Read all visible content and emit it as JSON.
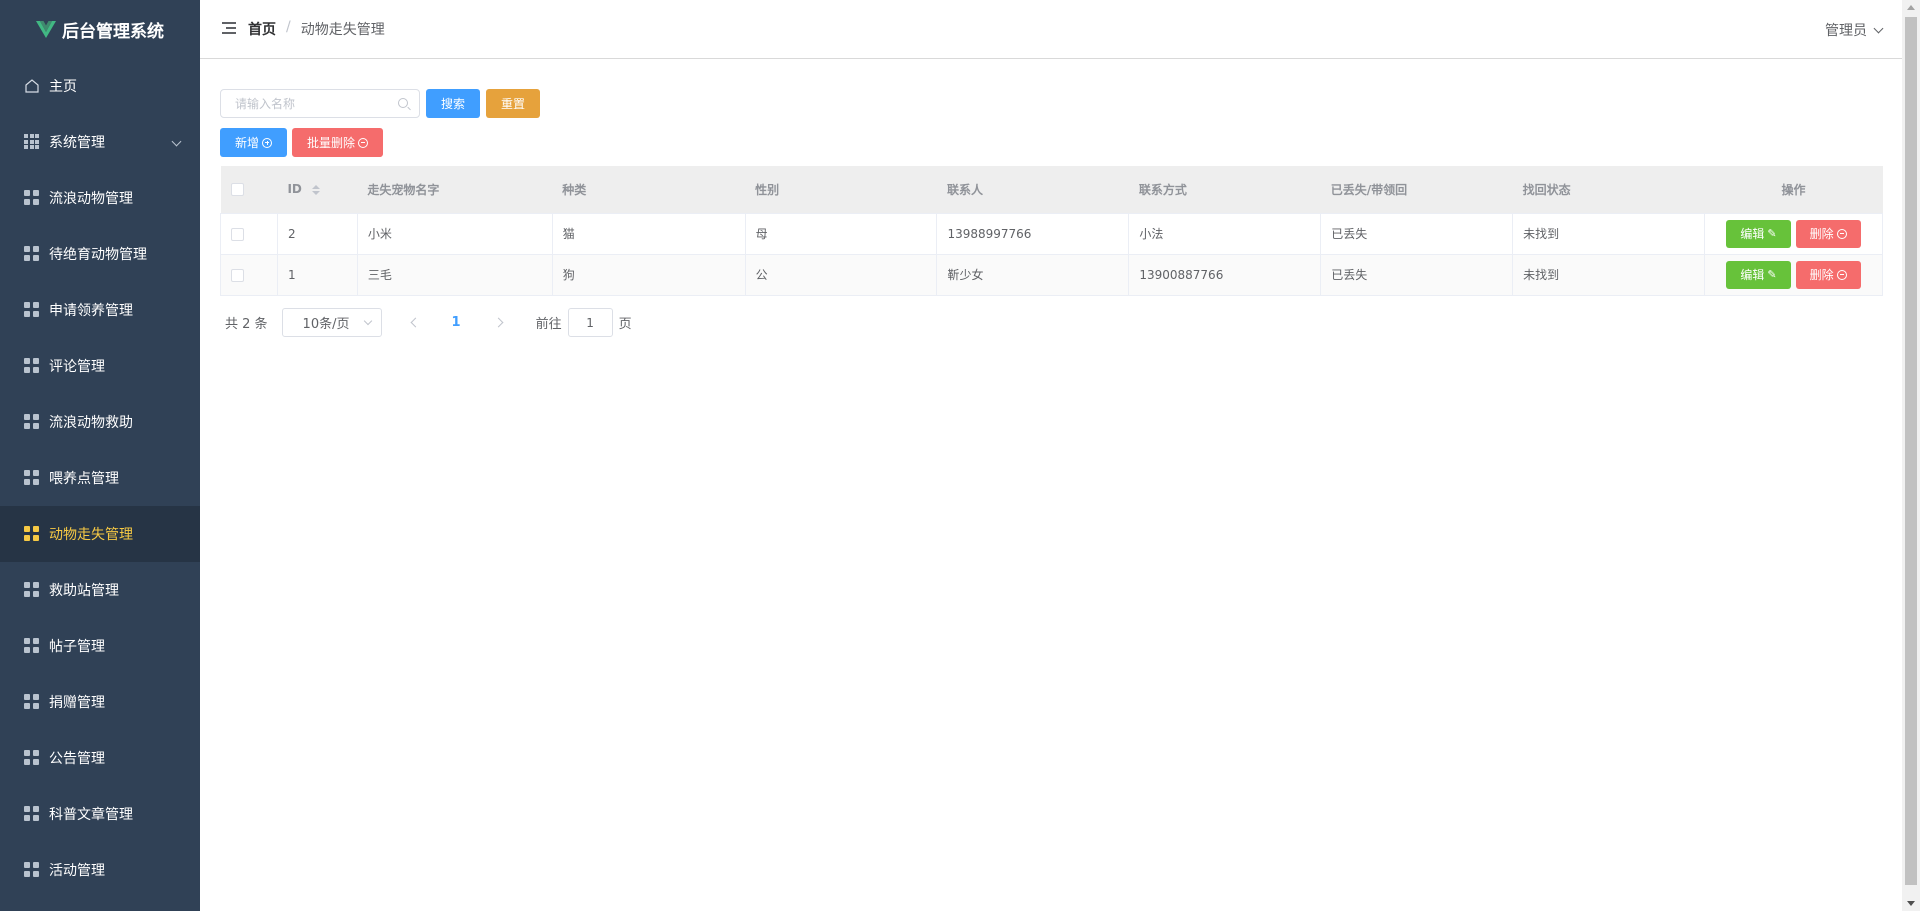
{
  "app": {
    "title": "后台管理系统",
    "brand_color": "#41b883"
  },
  "sidebar": {
    "items": [
      {
        "label": "主页",
        "icon": "home-icon"
      },
      {
        "label": "系统管理",
        "icon": "grid-icon"
      },
      {
        "label": "流浪动物管理",
        "icon": "menu-icon"
      },
      {
        "label": "待绝育动物管理",
        "icon": "menu-icon"
      },
      {
        "label": "申请领养管理",
        "icon": "menu-icon"
      },
      {
        "label": "评论管理",
        "icon": "menu-icon"
      },
      {
        "label": "流浪动物救助",
        "icon": "menu-icon"
      },
      {
        "label": "喂养点管理",
        "icon": "menu-icon"
      },
      {
        "label": "动物走失管理",
        "icon": "menu-icon"
      },
      {
        "label": "救助站管理",
        "icon": "menu-icon"
      },
      {
        "label": "帖子管理",
        "icon": "menu-icon"
      },
      {
        "label": "捐赠管理",
        "icon": "menu-icon"
      },
      {
        "label": "公告管理",
        "icon": "menu-icon"
      },
      {
        "label": "科普文章管理",
        "icon": "menu-icon"
      },
      {
        "label": "活动管理",
        "icon": "menu-icon"
      }
    ],
    "active_index": 8
  },
  "header": {
    "breadcrumb_home": "首页",
    "breadcrumb_sep": "/",
    "breadcrumb_current": "动物走失管理",
    "user": "管理员"
  },
  "search": {
    "placeholder": "请输入名称",
    "search_label": "搜索",
    "reset_label": "重置"
  },
  "actions": {
    "add_label": "新增",
    "batch_delete_label": "批量删除"
  },
  "table": {
    "columns": [
      "ID",
      "走失宠物名字",
      "种类",
      "性别",
      "联系人",
      "联系方式",
      "已丢失/带领回",
      "找回状态",
      "操作"
    ],
    "rows": [
      [
        "2",
        "小米",
        "猫",
        "母",
        "13988997766",
        "小法",
        "已丢失",
        "未找到"
      ],
      [
        "1",
        "三毛",
        "狗",
        "公",
        "靳少女",
        "13900887766",
        "已丢失",
        "未找到"
      ]
    ],
    "edit_label": "编辑",
    "delete_label": "删除"
  },
  "pagination": {
    "total_text": "共 2 条",
    "page_size": "10条/页",
    "current_page": "1",
    "goto_label": "前往",
    "goto_value": "1",
    "page_suffix": "页"
  },
  "colors": {
    "sidebar_bg": "#304156",
    "active_text": "#f6c944",
    "primary": "#409eff",
    "warning": "#e6a23c",
    "danger": "#f56c6c",
    "success": "#67c23a"
  }
}
